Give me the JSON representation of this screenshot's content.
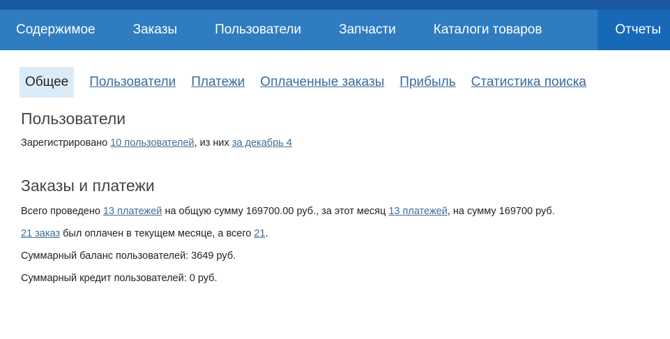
{
  "nav": {
    "items": [
      "Содержимое",
      "Заказы",
      "Пользователи",
      "Запчасти",
      "Каталоги товаров",
      "Отчеты"
    ]
  },
  "tabs": [
    "Общее",
    "Пользователи",
    "Платежи",
    "Оплаченные заказы",
    "Прибыль",
    "Статистика поиска"
  ],
  "users_section": {
    "title": "Пользователи",
    "text1": "Зарегистрировано ",
    "link1": "10 пользователей",
    "text2": ", из них ",
    "link2": "за декабрь 4"
  },
  "orders_section": {
    "title": "Заказы и платежи",
    "line1": {
      "t1": "Всего проведено ",
      "l1": "13 платежей",
      "t2": " на общую сумму 169700.00 руб., за этот месяц ",
      "l2": "13 платежей",
      "t3": ", на сумму 169700 руб."
    },
    "line2": {
      "l1": "21 заказ",
      "t1": " был оплачен в текущем месяце, а всего ",
      "l2": "21",
      "t2": "."
    },
    "line3": "Суммарный баланс пользователей: 3649 руб.",
    "line4": "Суммарный кредит пользователей: 0 руб."
  }
}
